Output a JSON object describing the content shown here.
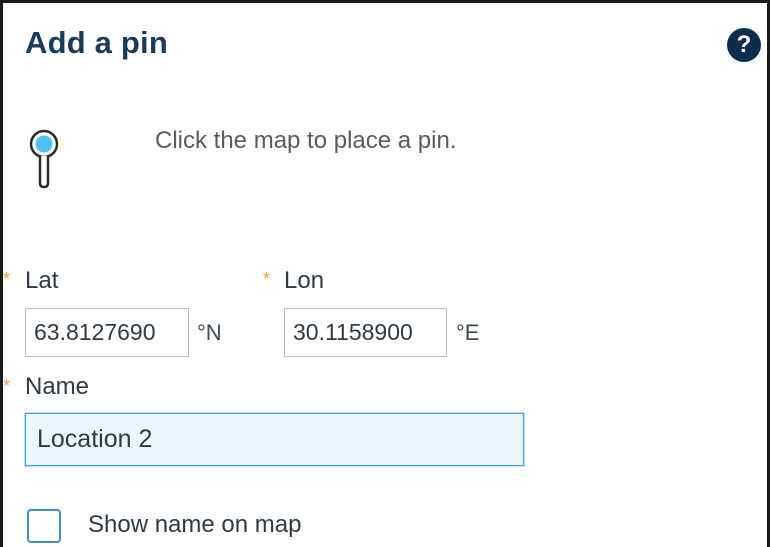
{
  "panel": {
    "title": "Add a pin",
    "help_icon": "?",
    "instruction": "Click the map to place a pin."
  },
  "icons": {
    "pin": "map-pin-icon",
    "help": "question-circle-icon"
  },
  "form": {
    "required_marker": "*",
    "lat": {
      "label": "Lat",
      "value": "63.8127690",
      "unit": "°N"
    },
    "lon": {
      "label": "Lon",
      "value": "30.1158900",
      "unit": "°E"
    },
    "name": {
      "label": "Name",
      "value": "Location 2"
    },
    "show_name": {
      "label": "Show name on map",
      "checked": false
    }
  },
  "colors": {
    "title": "#1b3b5c",
    "required_star": "#e8a13a",
    "focus_border": "#38a6d6",
    "focus_background": "#eaf6fb",
    "pin_fill": "#4fc3ea",
    "checkbox_border": "#3d8fc6"
  }
}
